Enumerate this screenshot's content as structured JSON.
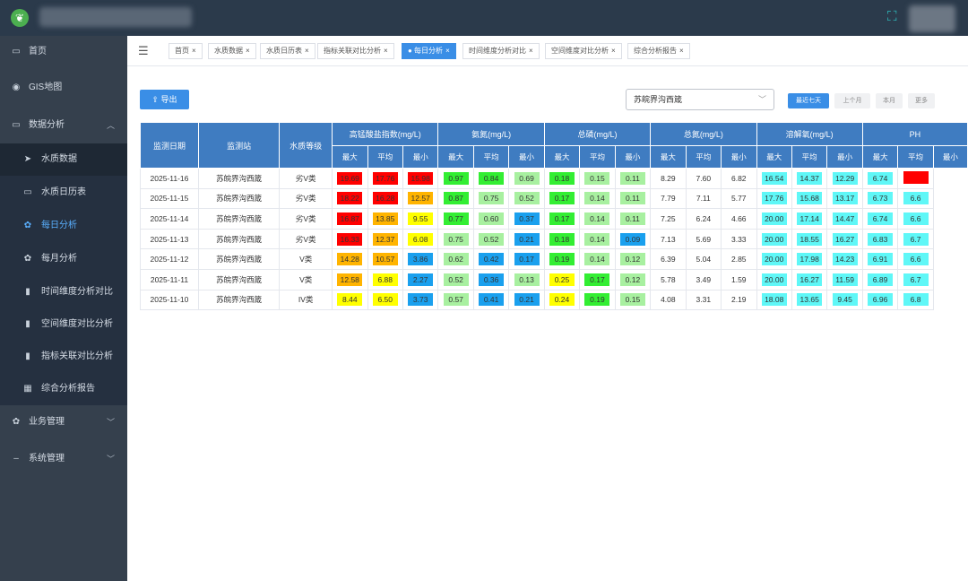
{
  "colors": {
    "red": "#ff0000",
    "orange": "#ffb400",
    "yellow": "#ffff00",
    "green": "#33ee33",
    "light_green": "#a8f0a0",
    "blue": "#1aa0ee",
    "cyan": "#5ff7f7",
    "none": ""
  },
  "sidebar": {
    "items": [
      {
        "label": "首页",
        "icon": "monitor-icon",
        "glyph": "▭"
      },
      {
        "label": "GIS地图",
        "icon": "eye-icon",
        "glyph": "◉"
      },
      {
        "label": "数据分析",
        "icon": "monitor-icon",
        "glyph": "▭",
        "expanded": true
      }
    ],
    "sub_items": [
      {
        "label": "水质数据",
        "icon": "send-icon",
        "glyph": "➤"
      },
      {
        "label": "水质日历表",
        "icon": "monitor-icon",
        "glyph": "▭"
      },
      {
        "label": "每日分析",
        "icon": "gear-icon",
        "glyph": "✿"
      },
      {
        "label": "每月分析",
        "icon": "gear-icon",
        "glyph": "✿"
      },
      {
        "label": "时间维度分析对比",
        "icon": "bar-chart-icon",
        "glyph": "▮"
      },
      {
        "label": "空间维度对比分析",
        "icon": "bar-chart-icon",
        "glyph": "▮"
      },
      {
        "label": "指标关联对比分析",
        "icon": "bar-chart-icon",
        "glyph": "▮"
      },
      {
        "label": "综合分析报告",
        "icon": "grid-icon",
        "glyph": "▦"
      }
    ],
    "bottom_items": [
      {
        "label": "业务管理",
        "icon": "gear-icon",
        "glyph": "✿"
      },
      {
        "label": "系统管理",
        "icon": "dash-icon",
        "glyph": "–"
      }
    ]
  },
  "tabs": [
    {
      "label": "首页",
      "active": false
    },
    {
      "label": "水质数据",
      "active": false
    },
    {
      "label": "水质日历表",
      "active": false
    },
    {
      "label": "指标关联对比分析",
      "active": false
    },
    {
      "label": "● 每日分析",
      "active": true
    },
    {
      "label": "时间维度分析对比",
      "active": false
    },
    {
      "label": "空间维度对比分析",
      "active": false
    },
    {
      "label": "综合分析报告",
      "active": false
    }
  ],
  "toolbar": {
    "export_label": "导出",
    "station_value": "苏皖界沟西箴",
    "ranges": [
      {
        "label": "最近七天",
        "active": true
      },
      {
        "label": "上个月",
        "active": false
      },
      {
        "label": "本月",
        "active": false
      },
      {
        "label": "更多",
        "active": false
      }
    ]
  },
  "table": {
    "fixed_headers": [
      "监测日期",
      "监测站",
      "水质等级"
    ],
    "groups": [
      "高锰酸盐指数(mg/L)",
      "氨氮(mg/L)",
      "总磷(mg/L)",
      "总氮(mg/L)",
      "溶解氧(mg/L)",
      "PH"
    ],
    "sub_headers": [
      "最大",
      "平均",
      "最小"
    ],
    "rows": [
      {
        "date": "2025-11-16",
        "station": "苏皖界沟西箴",
        "grade": "劣V类",
        "values": [
          [
            "19.69",
            "red"
          ],
          [
            "17.76",
            "red"
          ],
          [
            "15.98",
            "red"
          ],
          [
            "0.97",
            "green"
          ],
          [
            "0.84",
            "green"
          ],
          [
            "0.69",
            "light_green"
          ],
          [
            "0.18",
            "green"
          ],
          [
            "0.15",
            "light_green"
          ],
          [
            "0.11",
            "light_green"
          ],
          [
            "8.29",
            "none"
          ],
          [
            "7.60",
            "none"
          ],
          [
            "6.82",
            "none"
          ],
          [
            "16.54",
            "cyan"
          ],
          [
            "14.37",
            "cyan"
          ],
          [
            "12.29",
            "cyan"
          ],
          [
            "6.74",
            "cyan"
          ],
          [
            "",
            "red"
          ]
        ]
      },
      {
        "date": "2025-11-15",
        "station": "苏皖界沟西箴",
        "grade": "劣V类",
        "values": [
          [
            "18.22",
            "red"
          ],
          [
            "16.28",
            "red"
          ],
          [
            "12.57",
            "orange"
          ],
          [
            "0.87",
            "green"
          ],
          [
            "0.75",
            "light_green"
          ],
          [
            "0.52",
            "light_green"
          ],
          [
            "0.17",
            "green"
          ],
          [
            "0.14",
            "light_green"
          ],
          [
            "0.11",
            "light_green"
          ],
          [
            "7.79",
            "none"
          ],
          [
            "7.11",
            "none"
          ],
          [
            "5.77",
            "none"
          ],
          [
            "17.76",
            "cyan"
          ],
          [
            "15.68",
            "cyan"
          ],
          [
            "13.17",
            "cyan"
          ],
          [
            "6.73",
            "cyan"
          ],
          [
            "6.6",
            "cyan"
          ]
        ]
      },
      {
        "date": "2025-11-14",
        "station": "苏皖界沟西箴",
        "grade": "劣V类",
        "values": [
          [
            "16.87",
            "red"
          ],
          [
            "13.85",
            "orange"
          ],
          [
            "9.55",
            "yellow"
          ],
          [
            "0.77",
            "green"
          ],
          [
            "0.60",
            "light_green"
          ],
          [
            "0.37",
            "blue"
          ],
          [
            "0.17",
            "green"
          ],
          [
            "0.14",
            "light_green"
          ],
          [
            "0.11",
            "light_green"
          ],
          [
            "7.25",
            "none"
          ],
          [
            "6.24",
            "none"
          ],
          [
            "4.66",
            "none"
          ],
          [
            "20.00",
            "cyan"
          ],
          [
            "17.14",
            "cyan"
          ],
          [
            "14.47",
            "cyan"
          ],
          [
            "6.74",
            "cyan"
          ],
          [
            "6.6",
            "cyan"
          ]
        ]
      },
      {
        "date": "2025-11-13",
        "station": "苏皖界沟西箴",
        "grade": "劣V类",
        "values": [
          [
            "16.33",
            "red"
          ],
          [
            "12.37",
            "orange"
          ],
          [
            "6.08",
            "yellow"
          ],
          [
            "0.75",
            "light_green"
          ],
          [
            "0.52",
            "light_green"
          ],
          [
            "0.21",
            "blue"
          ],
          [
            "0.18",
            "green"
          ],
          [
            "0.14",
            "light_green"
          ],
          [
            "0.09",
            "blue"
          ],
          [
            "7.13",
            "none"
          ],
          [
            "5.69",
            "none"
          ],
          [
            "3.33",
            "none"
          ],
          [
            "20.00",
            "cyan"
          ],
          [
            "18.55",
            "cyan"
          ],
          [
            "16.27",
            "cyan"
          ],
          [
            "6.83",
            "cyan"
          ],
          [
            "6.7",
            "cyan"
          ]
        ]
      },
      {
        "date": "2025-11-12",
        "station": "苏皖界沟西箴",
        "grade": "V类",
        "values": [
          [
            "14.28",
            "orange"
          ],
          [
            "10.57",
            "orange"
          ],
          [
            "3.86",
            "blue"
          ],
          [
            "0.62",
            "light_green"
          ],
          [
            "0.42",
            "blue"
          ],
          [
            "0.17",
            "blue"
          ],
          [
            "0.19",
            "green"
          ],
          [
            "0.14",
            "light_green"
          ],
          [
            "0.12",
            "light_green"
          ],
          [
            "6.39",
            "none"
          ],
          [
            "5.04",
            "none"
          ],
          [
            "2.85",
            "none"
          ],
          [
            "20.00",
            "cyan"
          ],
          [
            "17.98",
            "cyan"
          ],
          [
            "14.23",
            "cyan"
          ],
          [
            "6.91",
            "cyan"
          ],
          [
            "6.6",
            "cyan"
          ]
        ]
      },
      {
        "date": "2025-11-11",
        "station": "苏皖界沟西箴",
        "grade": "V类",
        "values": [
          [
            "12.58",
            "orange"
          ],
          [
            "6.88",
            "yellow"
          ],
          [
            "2.27",
            "blue"
          ],
          [
            "0.52",
            "light_green"
          ],
          [
            "0.36",
            "blue"
          ],
          [
            "0.13",
            "light_green"
          ],
          [
            "0.25",
            "yellow"
          ],
          [
            "0.17",
            "green"
          ],
          [
            "0.12",
            "light_green"
          ],
          [
            "5.78",
            "none"
          ],
          [
            "3.49",
            "none"
          ],
          [
            "1.59",
            "none"
          ],
          [
            "20.00",
            "cyan"
          ],
          [
            "16.27",
            "cyan"
          ],
          [
            "11.59",
            "cyan"
          ],
          [
            "6.89",
            "cyan"
          ],
          [
            "6.7",
            "cyan"
          ]
        ]
      },
      {
        "date": "2025-11-10",
        "station": "苏皖界沟西箴",
        "grade": "IV类",
        "values": [
          [
            "8.44",
            "yellow"
          ],
          [
            "6.50",
            "yellow"
          ],
          [
            "3.73",
            "blue"
          ],
          [
            "0.57",
            "light_green"
          ],
          [
            "0.41",
            "blue"
          ],
          [
            "0.21",
            "blue"
          ],
          [
            "0.24",
            "yellow"
          ],
          [
            "0.19",
            "green"
          ],
          [
            "0.15",
            "light_green"
          ],
          [
            "4.08",
            "none"
          ],
          [
            "3.31",
            "none"
          ],
          [
            "2.19",
            "none"
          ],
          [
            "18.08",
            "cyan"
          ],
          [
            "13.65",
            "cyan"
          ],
          [
            "9.45",
            "cyan"
          ],
          [
            "6.96",
            "cyan"
          ],
          [
            "6.8",
            "cyan"
          ]
        ]
      }
    ]
  }
}
